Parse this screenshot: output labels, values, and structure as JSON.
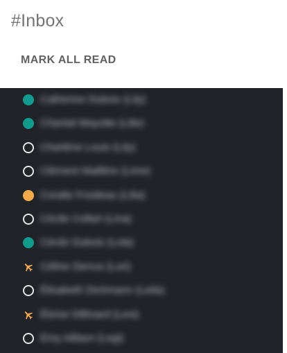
{
  "header": {
    "title": "#Inbox",
    "mark_all_read_label": "MARK ALL READ"
  },
  "colors": {
    "teal": "#0f9b8e",
    "orange": "#f6a94a",
    "ring": "#e6e6e6",
    "list_bg": "#202328"
  },
  "contacts": [
    {
      "name": "Catherine Dubois (Lily)",
      "status_icon": "online-dot-icon",
      "color": "#0f9b8e"
    },
    {
      "name": "Chantal Mayotte (Lilie)",
      "status_icon": "online-dot-icon",
      "color": "#0f9b8e"
    },
    {
      "name": "Charlène Louis (Lily)",
      "status_icon": "offline-ring-icon",
      "color": "#e6e6e6"
    },
    {
      "name": "Clément Maillère (Lime)",
      "status_icon": "offline-ring-icon",
      "color": "#e6e6e6"
    },
    {
      "name": "Coralie Froideau (Lilia)",
      "status_icon": "away-dot-icon",
      "color": "#f6a94a"
    },
    {
      "name": "Cécile Collart (Lina)",
      "status_icon": "offline-ring-icon",
      "color": "#e6e6e6"
    },
    {
      "name": "Cécile Dubois (Lola)",
      "status_icon": "online-dot-icon",
      "color": "#0f9b8e"
    },
    {
      "name": "Céline Derrus (Lori)",
      "status_icon": "airplane-icon",
      "color": "#f6a94a"
    },
    {
      "name": "Élisabeth Dichmann (Leila)",
      "status_icon": "offline-ring-icon",
      "color": "#e6e6e6"
    },
    {
      "name": "Éloïse Dillmard (Lexi)",
      "status_icon": "airplane-icon",
      "color": "#f6a94a"
    },
    {
      "name": "Emy Aillaon (Legi)",
      "status_icon": "offline-ring-icon",
      "color": "#e6e6e6"
    }
  ]
}
